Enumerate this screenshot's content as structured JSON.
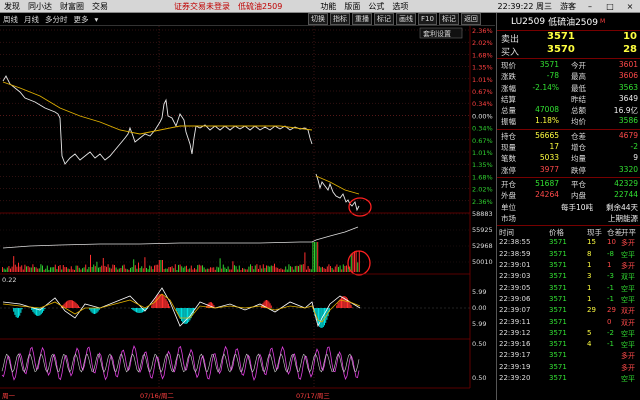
{
  "menubar": {
    "left_items": [
      "发现",
      "同小达",
      "财富圈",
      "交易"
    ],
    "warning": "证券交易未登录",
    "current": "低硫油2509",
    "right_items": [
      "功能",
      "版面",
      "公式",
      "选项"
    ],
    "time": "22:39:22 周三",
    "guest": "游客"
  },
  "toolbar": {
    "tabs": [
      "周线",
      "月线",
      "多分时",
      "更多"
    ],
    "buttons": [
      "切换",
      "指标",
      "重播",
      "标记",
      "画线",
      "F10",
      "标记",
      "返回"
    ]
  },
  "chart": {
    "settings_label": "套利设置",
    "price_pct_labels": [
      "2.36%",
      "2.02%",
      "1.68%",
      "1.35%",
      "1.01%",
      "0.67%",
      "0.34%",
      "0.00%",
      "0.34%",
      "0.67%",
      "1.01%",
      "1.35%",
      "1.68%",
      "2.02%",
      "2.36%"
    ],
    "price_pct_colors": [
      "red",
      "red",
      "red",
      "red",
      "red",
      "red",
      "red",
      "white",
      "green",
      "green",
      "green",
      "green",
      "green",
      "green",
      "green"
    ],
    "volume_labels": [
      "58883",
      "55925",
      "52968",
      "50010"
    ],
    "oscillator_value": "0.22",
    "osc_labels": [
      "5.99",
      "0.00",
      "5.99"
    ],
    "bottom_labels": [
      "0.50",
      "0.50"
    ],
    "date_labels": [
      "07/16/周二",
      "07/17/周三"
    ],
    "first_date_label": "周一"
  },
  "quote": {
    "code": "LU2509",
    "name": "低硫油2509",
    "tag": "M",
    "ask_label": "卖出",
    "ask_price": "3571",
    "ask_vol": "10",
    "bid_label": "买入",
    "bid_price": "3570",
    "bid_vol": "28",
    "rows": [
      {
        "l1": "现价",
        "v1": "3571",
        "l2": "今开",
        "v2": "3601"
      },
      {
        "l1": "涨跌",
        "v1": "-78",
        "l2": "最高",
        "v2": "3606"
      },
      {
        "l1": "涨幅",
        "v1": "-2.14%",
        "l2": "最低",
        "v2": "3563"
      },
      {
        "l1": "结算",
        "v1": "",
        "l2": "昨结",
        "v2": "3649"
      },
      {
        "l1": "总量",
        "v1": "47008",
        "l2": "总额",
        "v2": "16.9亿"
      },
      {
        "l1": "振幅",
        "v1": "1.18%",
        "l2": "均价",
        "v2": "3586"
      }
    ],
    "rows2": [
      {
        "l1": "持仓",
        "v1": "56665",
        "l2": "仓差",
        "v2": "4679"
      },
      {
        "l1": "现量",
        "v1": "17",
        "l2": "增仓",
        "v2": "-2"
      },
      {
        "l1": "笔数",
        "v1": "5033",
        "l2": "均量",
        "v2": "9"
      },
      {
        "l1": "涨停",
        "v1": "3977",
        "l2": "跌停",
        "v2": "3320"
      }
    ],
    "rows3": [
      {
        "l1": "开仓",
        "v1": "51687",
        "l2": "平仓",
        "v2": "42329"
      },
      {
        "l1": "外盘",
        "v1": "24264",
        "l2": "内盘",
        "v2": "22744"
      }
    ],
    "unit_label": "单位",
    "unit_value": "每手10吨",
    "remain": "剩余44天",
    "market_label": "市场",
    "market_value": "上期能源"
  },
  "ticks": {
    "headers": [
      "时间",
      "价格",
      "现手",
      "仓差",
      "开平"
    ],
    "rows": [
      {
        "time": "22:38:55",
        "price": "3571",
        "vol": "15",
        "oi": "10",
        "type": "多开"
      },
      {
        "time": "22:38:59",
        "price": "3571",
        "vol": "8",
        "oi": "-8",
        "type": "空平"
      },
      {
        "time": "22:39:01",
        "price": "3571",
        "vol": "1",
        "oi": "1",
        "type": "多开"
      },
      {
        "time": "22:39:03",
        "price": "3571",
        "vol": "3",
        "oi": "-3",
        "type": "双平"
      },
      {
        "time": "22:39:05",
        "price": "3571",
        "vol": "1",
        "oi": "-1",
        "type": "空平"
      },
      {
        "time": "22:39:06",
        "price": "3571",
        "vol": "1",
        "oi": "-1",
        "type": "空平"
      },
      {
        "time": "22:39:07",
        "price": "3571",
        "vol": "29",
        "oi": "29",
        "type": "双开"
      },
      {
        "time": "22:39:11",
        "price": "3571",
        "vol": "",
        "oi": "0",
        "type": "双开"
      },
      {
        "time": "22:39:12",
        "price": "3571",
        "vol": "5",
        "oi": "-2",
        "type": "空平"
      },
      {
        "time": "22:39:16",
        "price": "3571",
        "vol": "4",
        "oi": "-1",
        "type": "空平"
      },
      {
        "time": "22:39:17",
        "price": "3571",
        "vol": "",
        "oi": "",
        "type": "多开"
      },
      {
        "time": "22:39:19",
        "price": "3571",
        "vol": "",
        "oi": "",
        "type": "多开"
      },
      {
        "time": "22:39:20",
        "price": "3571",
        "vol": "",
        "oi": "",
        "type": "空平"
      }
    ]
  }
}
